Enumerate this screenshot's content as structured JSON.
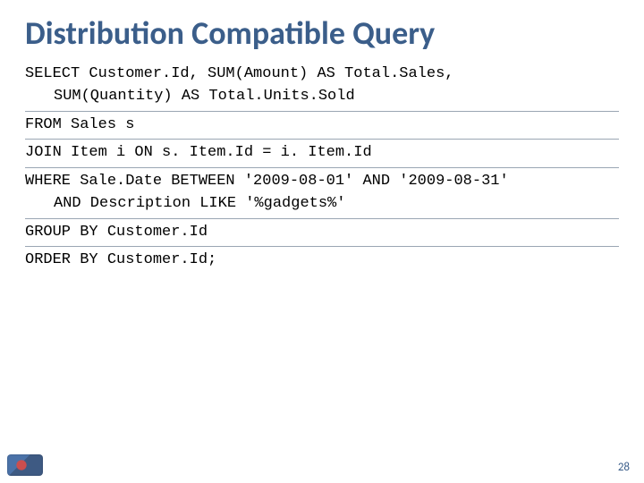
{
  "title": "Distribution Compatible Query",
  "page_number": "28",
  "sql": {
    "select": {
      "line1": "SELECT Customer.Id, SUM(Amount) AS Total.Sales,",
      "line2": "SUM(Quantity) AS Total.Units.Sold"
    },
    "from": "FROM Sales s",
    "join": "JOIN Item i ON s. Item.Id = i. Item.Id",
    "where": {
      "line1": "WHERE Sale.Date BETWEEN '2009-08-01' AND '2009-08-31'",
      "line2": "AND Description LIKE '%gadgets%'"
    },
    "group_by": "GROUP BY Customer.Id",
    "order_by": "ORDER BY Customer.Id;"
  }
}
